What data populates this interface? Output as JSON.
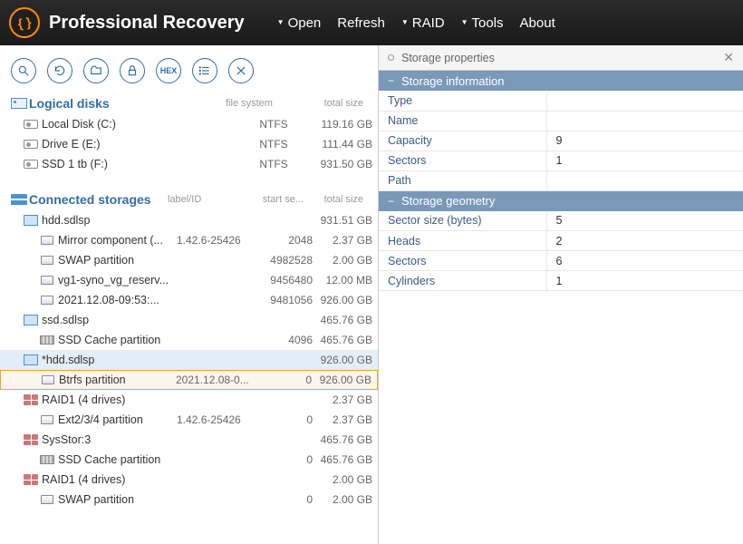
{
  "app": {
    "title": "Professional Recovery"
  },
  "menu": {
    "open": "Open",
    "refresh": "Refresh",
    "raid": "RAID",
    "tools": "Tools",
    "about": "About"
  },
  "sections": {
    "logical": {
      "title": "Logical disks",
      "col_fs": "file system",
      "col_size": "total size"
    },
    "connected": {
      "title": "Connected storages",
      "col_label": "label/ID",
      "col_sec": "start se...",
      "col_size": "total size"
    }
  },
  "logical_disks": [
    {
      "name": "Local Disk (C:)",
      "fs": "NTFS",
      "size": "119.16 GB"
    },
    {
      "name": "Drive E (E:)",
      "fs": "NTFS",
      "size": "111.44 GB"
    },
    {
      "name": "SSD 1 tb (F:)",
      "fs": "NTFS",
      "size": "931.50 GB"
    }
  ],
  "storages": [
    {
      "type": "sdlsp",
      "indent": 1,
      "name": "hdd.sdlsp",
      "label": "",
      "sec": "",
      "size": "931.51 GB"
    },
    {
      "type": "part",
      "indent": 2,
      "name": "Mirror component (...",
      "label": "1.42.6-25426",
      "sec": "2048",
      "size": "2.37 GB"
    },
    {
      "type": "part",
      "indent": 2,
      "name": "SWAP partition",
      "label": "",
      "sec": "4982528",
      "size": "2.00 GB"
    },
    {
      "type": "part",
      "indent": 2,
      "name": "vg1-syno_vg_reserv...",
      "label": "",
      "sec": "9456480",
      "size": "12.00 MB"
    },
    {
      "type": "part",
      "indent": 2,
      "name": "2021.12.08-09:53:...",
      "label": "",
      "sec": "9481056",
      "size": "926.00 GB"
    },
    {
      "type": "sdlsp",
      "indent": 1,
      "name": "ssd.sdlsp",
      "label": "",
      "sec": "",
      "size": "465.76 GB"
    },
    {
      "type": "ssd",
      "indent": 2,
      "name": "SSD Cache partition",
      "label": "",
      "sec": "4096",
      "size": "465.76 GB"
    },
    {
      "type": "sdlsp",
      "indent": 1,
      "name": "*hdd.sdlsp",
      "label": "",
      "sec": "",
      "size": "926.00 GB",
      "selected": true
    },
    {
      "type": "part",
      "indent": 2,
      "name": "Btrfs partition",
      "label": "2021.12.08-0...",
      "sec": "0",
      "size": "926.00 GB",
      "highlight": true
    },
    {
      "type": "raid",
      "indent": 1,
      "name": "RAID1 (4 drives)",
      "label": "",
      "sec": "",
      "size": "2.37 GB"
    },
    {
      "type": "part",
      "indent": 2,
      "name": "Ext2/3/4 partition",
      "label": "1.42.6-25426",
      "sec": "0",
      "size": "2.37 GB"
    },
    {
      "type": "raid",
      "indent": 1,
      "name": "SysStor:3",
      "label": "",
      "sec": "",
      "size": "465.76 GB"
    },
    {
      "type": "ssd",
      "indent": 2,
      "name": "SSD Cache partition",
      "label": "",
      "sec": "0",
      "size": "465.76 GB"
    },
    {
      "type": "raid",
      "indent": 1,
      "name": "RAID1 (4 drives)",
      "label": "",
      "sec": "",
      "size": "2.00 GB"
    },
    {
      "type": "part",
      "indent": 2,
      "name": "SWAP partition",
      "label": "",
      "sec": "0",
      "size": "2.00 GB"
    }
  ],
  "panel": {
    "tab": "Storage properties",
    "groups": [
      {
        "title": "Storage information",
        "rows": [
          {
            "k": "Type",
            "v": ""
          },
          {
            "k": "Name",
            "v": ""
          },
          {
            "k": "Capacity",
            "v": "9"
          },
          {
            "k": "Sectors",
            "v": "1"
          },
          {
            "k": "Path",
            "v": ""
          }
        ]
      },
      {
        "title": "Storage geometry",
        "rows": [
          {
            "k": "Sector size (bytes)",
            "v": "5"
          },
          {
            "k": "Heads",
            "v": "2"
          },
          {
            "k": "Sectors",
            "v": "6"
          },
          {
            "k": "Cylinders",
            "v": "1"
          }
        ]
      }
    ]
  }
}
